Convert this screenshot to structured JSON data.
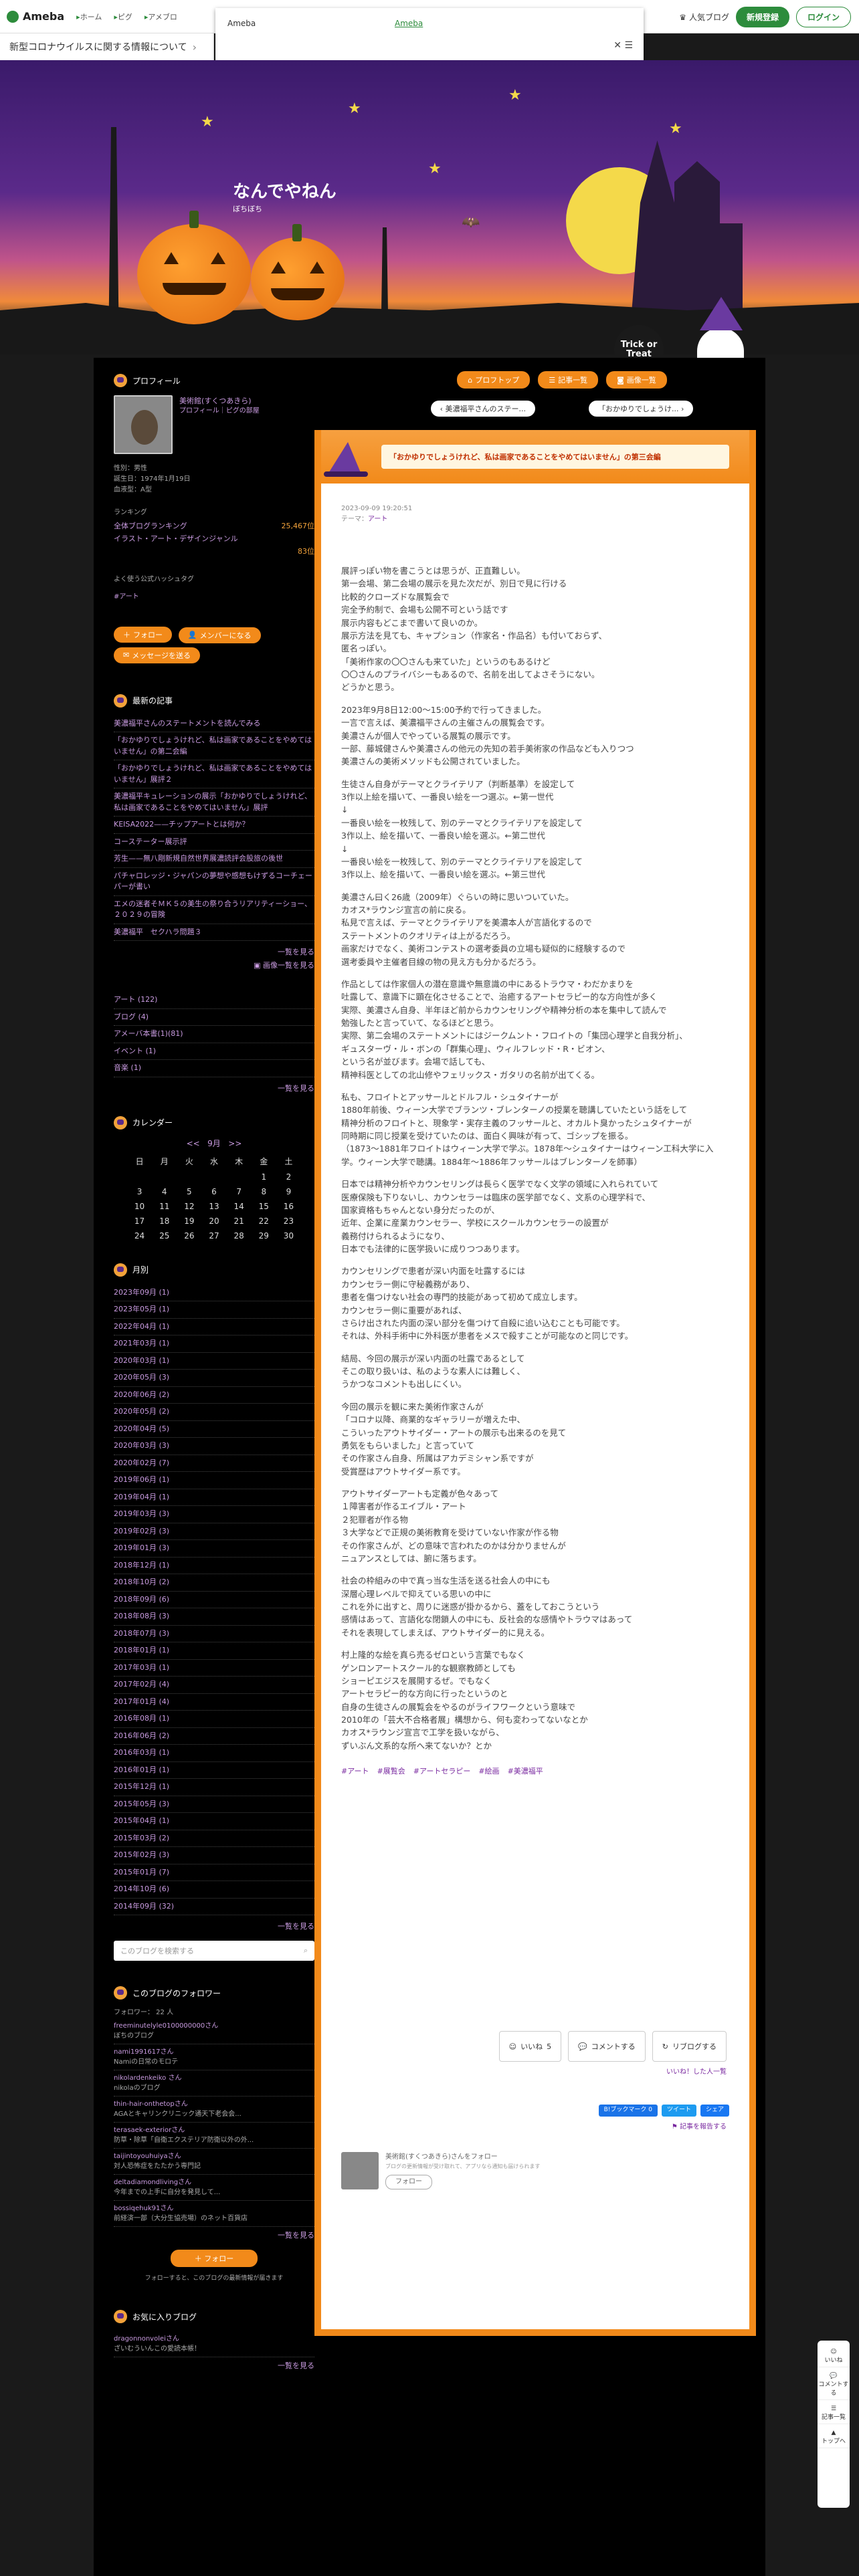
{
  "topbar": {
    "logo": "Ameba",
    "nav": [
      "ホーム",
      "ピグ",
      "アメブロ"
    ],
    "popular_blog": "人気ブログ",
    "signup": "新規登録",
    "login": "ログイン"
  },
  "news_bar": {
    "text": "新型コロナウイルスに関する情報について"
  },
  "dropdown": {
    "label": "Ameba",
    "link": "Ameba"
  },
  "header": {
    "title": "なんでやねん",
    "subtitle": "ぼちぼち",
    "badge": "Trick or Treat"
  },
  "profile": {
    "heading": "プロフィール",
    "name": "美術館(すくつあきら)",
    "name_sub": "プロフィール｜ピグの部屋",
    "gender": "性別：男性",
    "birth": "誕生日：1974年1月19日",
    "blood": "血液型：A型",
    "ranking_label": "ランキング",
    "rank1_label": "全体ブログランキング",
    "rank1_value": "25,467位",
    "rank2_label": "イラスト・アート・デザインジャンル",
    "rank2_value": "83位",
    "hashtag_label": "よく使う公式ハッシュタグ",
    "hashtag": "#アート",
    "follow": "フォロー",
    "member": "メンバーになる",
    "message": "メッセージを送る"
  },
  "recent": {
    "heading": "最新の記事",
    "items": [
      "美濃福平さんのステートメントを読んでみる",
      "「おかゆりでしょうけれど、私は画家であることをやめてはいません」の第二会編",
      "「おかゆりでしょうけれど、私は画家であることをやめてはいません」展評２",
      "美濃福平キュレーションの展示「おかゆりでしょうけれど、私は画家であることをやめてはいません」展評",
      "KEISA2022——チップアートとは何か？",
      "コーステーター展示評",
      "芳生——無八剛新規自然世界展濃読評会股旅の後世",
      "パチャロレッジ・ジャパンの夢想や感想もけずるコーチェーパーが書い",
      "エメの迷者そＭＫ５の美生の祭り合うリアリティーショー、２０２９の冒険",
      "美濃福平　セクハラ問題３"
    ],
    "more": "一覧を見る",
    "more2": "画像一覧を見る"
  },
  "themes": {
    "items": [
      "アート (122)",
      "ブログ (4)",
      "アメーバ本書(1)(81)",
      "イベント (1)",
      "音楽 (1)"
    ],
    "more": "一覧を見る"
  },
  "calendar": {
    "heading": "カレンダー",
    "month": "9月",
    "weekdays": [
      "日",
      "月",
      "火",
      "水",
      "木",
      "金",
      "土"
    ],
    "weeks": [
      [
        "",
        "",
        "",
        "",
        "",
        "1",
        "2"
      ],
      [
        "3",
        "4",
        "5",
        "6",
        "7",
        "8",
        "9"
      ],
      [
        "10",
        "11",
        "12",
        "13",
        "14",
        "15",
        "16"
      ],
      [
        "17",
        "18",
        "19",
        "20",
        "21",
        "22",
        "23"
      ],
      [
        "24",
        "25",
        "26",
        "27",
        "28",
        "29",
        "30"
      ]
    ]
  },
  "monthly": {
    "heading": "月別",
    "items": [
      "2023年09月 (1)",
      "2023年05月 (1)",
      "2022年04月 (1)",
      "2021年03月 (1)",
      "2020年03月 (1)",
      "2020年05月 (3)",
      "2020年06月 (2)",
      "2020年05月 (2)",
      "2020年04月 (5)",
      "2020年03月 (3)",
      "2020年02月 (7)",
      "2019年06月 (1)",
      "2019年04月 (1)",
      "2019年03月 (3)",
      "2019年02月 (3)",
      "2019年01月 (3)",
      "2018年12月 (1)",
      "2018年10月 (2)",
      "2018年09月 (6)",
      "2018年08月 (3)",
      "2018年07月 (3)",
      "2018年01月 (1)",
      "2017年03月 (1)",
      "2017年02月 (4)",
      "2017年01月 (4)",
      "2016年08月 (1)",
      "2016年06月 (2)",
      "2016年03月 (1)",
      "2016年01月 (1)",
      "2015年12月 (1)",
      "2015年05月 (3)",
      "2015年04月 (1)",
      "2015年03月 (2)",
      "2015年02月 (3)",
      "2015年01月 (7)",
      "2014年10月 (6)",
      "2014年09月 (32)"
    ],
    "more": "一覧を見る"
  },
  "search": {
    "placeholder": "このブログを検索する"
  },
  "followers": {
    "heading": "このブログのフォロワー",
    "count": "フォロワー： 22 人",
    "items": [
      {
        "id": "freeminutelyle0100000000さん",
        "name": "ぼちのブログ"
      },
      {
        "id": "nami1991617さん",
        "name": "Namiの日常のモロテ"
      },
      {
        "id": "nikolardenkeiko さん",
        "name": "nikolaのブログ"
      },
      {
        "id": "thin-hair-onthetopさん",
        "name": "AGAとキャリンクリニック通天下老会会..."
      },
      {
        "id": "terasaek-exteriorさん",
        "name": "防草・除草「自衛エクステリア防衛以外の外..."
      },
      {
        "id": "taijintoyouhuiyaさん",
        "name": "対人恐怖症をたたかう専門記"
      },
      {
        "id": "deltadiamondlivingさん",
        "name": "今年までの上手に自分を発見して..."
      },
      {
        "id": "bossiqehuk91さん",
        "name": "前経済一部（大分生協売場）のネット百貨店"
      }
    ],
    "more": "一覧を見る",
    "follow": "フォロー",
    "note": "フォローすると、このブログの最新情報が届きます"
  },
  "favorites": {
    "heading": "お気に入りブログ",
    "items": [
      {
        "id": "dragonnonvoleiさん",
        "name": "ざいむういんこの愛読本帳！"
      }
    ],
    "more": "一覧を見る"
  },
  "main": {
    "btn_profile": "プロフトップ",
    "btn_list": "記事一覧",
    "btn_images": "画像一覧",
    "prev": "美濃福平さんのステー...",
    "next": "「おかゆりでしょうけ...",
    "title": "「おかゆりでしょうけれど、私は画家であることをやめてはいません」の第三会編",
    "date": "2023-09-09 19:20:51",
    "theme_label": "テーマ：",
    "theme": "アート",
    "paragraphs": [
      "展評っぽい物を書こうとは思うが、正直難しい。\n第一会場、第二会場の展示を見た次だが、別日で見に行ける\n比較的クローズドな展覧会で\n完全予約制で、会場も公開不可という話です\n展示内容もどこまで書いて良いのか。\n展示方法を見ても、キャプション（作家名・作品名）も付いておらず、\n匿名っぽい。\n「美術作家の〇〇さんも来ていた」というのもあるけど\n〇〇さんのプライバシーもあるので、名前を出してよさそうにない。\nどうかと思う。",
      "2023年9月8日12:00〜15:00予約で行ってきました。\n一言で言えば、美濃福平さんの主催さんの展覧会です。\n美濃さんが個人でやっている展覧の展示です。\n一部、藤城健さんや美濃さんの他元の先知の若手美術家の作品なども入りつつ\n美濃さんの美術メソッドも公開されていました。",
      "生徒さん自身がテーマとクライテリア（判断基準）を設定して\n3作以上絵を描いて、一番良い絵を一つ選ぶ。←第一世代\n↓\n一番良い絵を一枚残して、別のテーマとクライテリアを設定して\n3作以上、絵を描いて、一番良い絵を選ぶ。←第二世代\n↓\n一番良い絵を一枚残して、別のテーマとクライテリアを設定して\n3作以上、絵を描いて、一番良い絵を選ぶ。←第三世代",
      "美濃さん曰く26歳（2009年）ぐらいの時に思いついていた。\nカオス*ラウンジ宣言の前に戻る。\n私見で言えば、テーマとクライテリアを美濃本人が言語化するので\nステートメントのクオリティは上がるだろう。\n画家だけでなく、美術コンテストの選考委員の立場も疑似的に経験するので\n選考委員や主催者目線の物の見え方も分かるだろう。",
      "作品としては作家個人の潜在意識や無意識の中にあるトラウマ・わだかまりを\n吐露して、意識下に顕在化させることで、治癒するアートセラピー的な方向性が多く\n実際、美濃さん自身、半年ほど前からカウンセリングや精神分析の本を集中して読んで\n勉強したと言っていて、なるほどと思う。\n実際、第二会場のステートメントにはジークムント・フロイトの「集団心理学と自我分析」、\nギュスターヴ・ル・ボンの「群集心理」、ウィルフレッド・R・ビオン、\nという名が並びます。会場で話しても、\n精神科医としての北山修やフェリックス・ガタリの名前が出てくる。",
      "私も、フロイトとアッサールとドルフル・シュタイナーが\n1880年前後、ウィーン大学でブランツ・ブレンターノの授業を聴講していたという話をして\n精神分析のフロイトと、現象学・実存主義のフッサールと、オカルト臭かったシュタイナーが\n同時期に同じ授業を受けていたのは、面白く興味が有って、ゴシップを振る。\n（1873〜1881年フロイトはウィーン大学で学ぶ。1878年〜シュタイナーはウィーン工科大学に入学。ウィーン大学で聴講。1884年〜1886年フッサールはブレンターノを師事）",
      "日本では精神分析やカウンセリングは長らく医学でなく文学の領域に入れられていて\n医療保険も下りないし、カウンセラーは臨床の医学部でなく、文系の心理学科で、\n国家資格もちゃんとない身分だったのが、\n近年、企業に産業カウンセラー、学校にスクールカウンセラーの設置が\n義務付けられるようになり、\n日本でも法律的に医学扱いに成りつつあります。",
      "カウンセリングで患者が深い内面を吐露するには\nカウンセラー側に守秘義務があり、\n患者を傷つけない社会の専門的技能があって初めて成立します。\nカウンセラー側に重要があれば、\nさらけ出された内面の深い部分を傷つけて自殺に追い込むことも可能です。\nそれは、外科手術中に外科医が患者をメスで殺すことが可能なのと同じです。",
      "結局、今回の展示が深い内面の吐露であるとして\nそこの取り扱いは、私のような素人には難しく、\nうかつなコメントも出しにくい。",
      "今回の展示を観に来た美術作家さんが\n「コロナ以降、商業的なギャラリーが増えた中、\nこういったアウトサイダー・アートの展示も出来るのを見て\n勇気をもらいました」と言っていて\nその作家さん自身、所属はアカデミシャン系ですが\n受賞歴はアウトサイダー系です。",
      "アウトサイダーアートも定義が色々あって\n１障害者が作るエイブル・アート\n２犯罪者が作る物\n３大学などで正規の美術教育を受けていない作家が作る物\nその作家さんが、どの意味で言われたのかは分かりませんが\nニュアンスとしては、腑に落ちます。",
      "社会の枠組みの中で真っ当な生活を送る社会人の中にも\n深層心理レベルで抑えている思いの中に\nこれを外に出すと、周りに迷惑が掛かるから、蓋をしておこうという\n感情はあって、言語化な閉鎖人の中にも、反社会的な感情やトラウマはあって\nそれを表現してしまえば、アウトサイダー的に見える。",
      "村上隆的な絵を真ら売るゼロという言葉でもなく\nゲンロンアートスクール的な観察教師としても\nショーピエジスを展開するぜ。でもなく\nアートセラピー的な方向に行ったというのと\n自身の生徒さんの展覧会をやるのがライフワークという意味で\n2010年の「芸大不合格者展」構想から、何も変わってないなとか\nカオス*ラウンジ宣言で工学を扱いながら、\nずいぶん文系的な所へ来てないか？とか"
    ],
    "tags": [
      "#アート",
      "#展覧会",
      "#アートセラピー",
      "#絵画",
      "#美濃福平"
    ],
    "like": "いいね",
    "like_count": "5",
    "comment": "コメントする",
    "reblog": "リブログする",
    "likes_link": "いいね！した人一覧",
    "share_bookmark": "B!ブックマーク",
    "share_bookmark_count": "0",
    "share_tweet": "ツイート",
    "share_fb": "シェア",
    "report": "記事を報告する",
    "follow_card_title": "美術館(すくつあきら)さんをフォロー",
    "follow_card_note": "ブログの更新情報が受け取れて、アプリなら通知も届けられます",
    "follow_card_btn": "フォロー"
  },
  "floating": [
    "いいね",
    "コメントする",
    "記事一覧",
    "トップへ"
  ]
}
